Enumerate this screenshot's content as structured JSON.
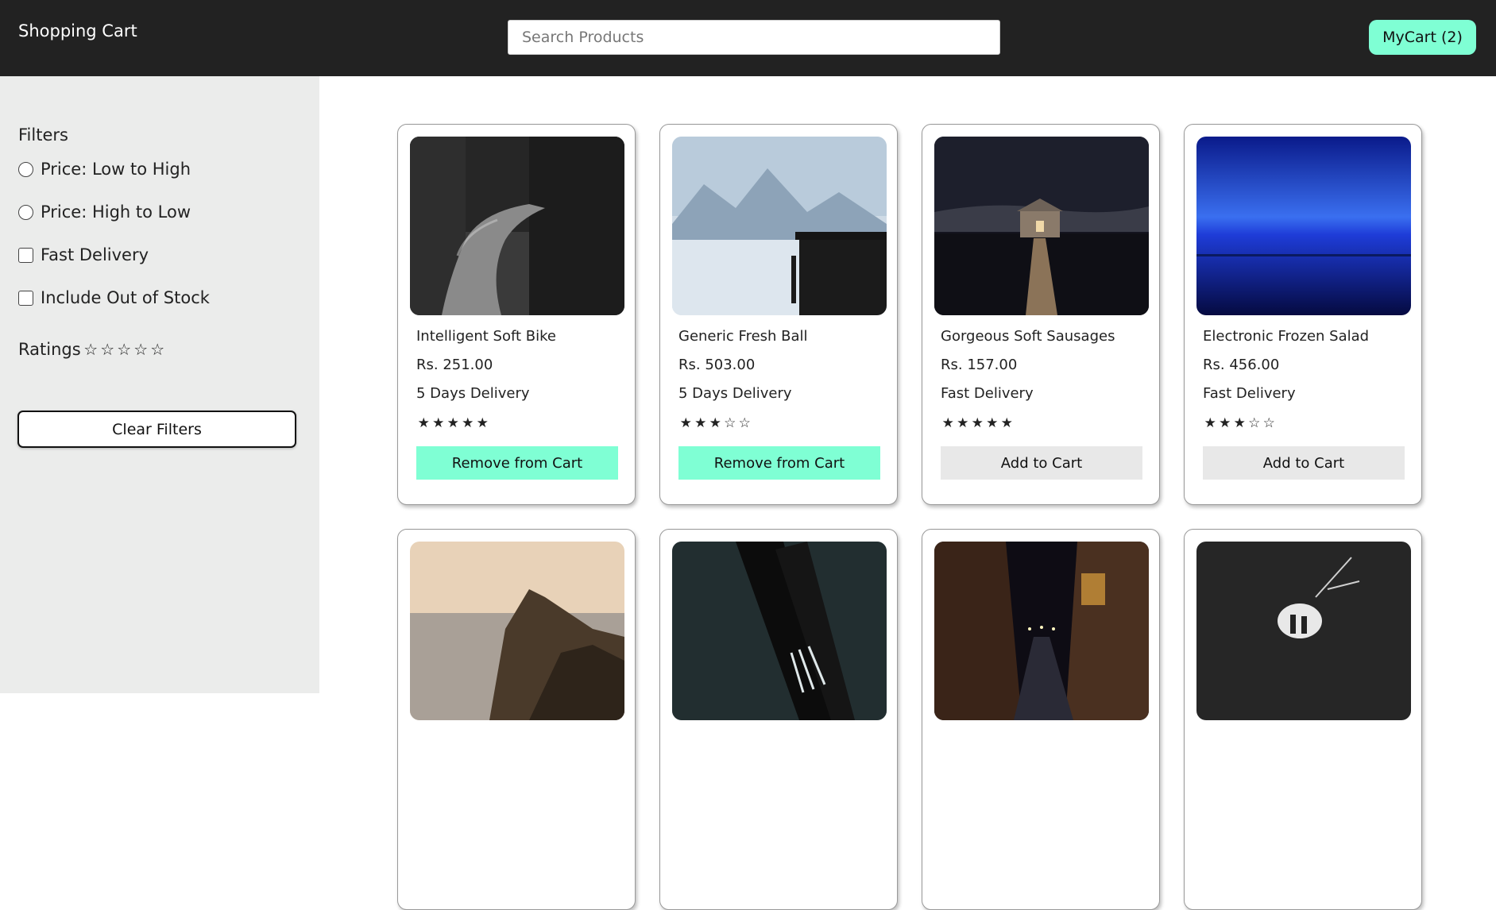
{
  "header": {
    "brand": "Shopping Cart",
    "search_placeholder": "Search Products",
    "cart_label": "MyCart (2)"
  },
  "sidebar": {
    "title": "Filters",
    "options": [
      {
        "type": "radio",
        "label": "Price: Low to High"
      },
      {
        "type": "radio",
        "label": "Price: High to Low"
      },
      {
        "type": "checkbox",
        "label": "Fast Delivery"
      },
      {
        "type": "checkbox",
        "label": "Include Out of Stock"
      }
    ],
    "ratings_label": "Ratings",
    "ratings_value": 0,
    "clear_label": "Clear Filters"
  },
  "products": [
    {
      "name": "Intelligent Soft Bike",
      "price": "Rs. 251.00",
      "delivery": "5 Days Delivery",
      "rating": 5,
      "button": "Remove from Cart",
      "in_cart": true,
      "image": "dark-forest-road"
    },
    {
      "name": "Generic Fresh Ball",
      "price": "Rs. 503.00",
      "delivery": "5 Days Delivery",
      "rating": 3,
      "button": "Remove from Cart",
      "in_cart": true,
      "image": "misty-lake-pier"
    },
    {
      "name": "Gorgeous Soft Sausages",
      "price": "Rs. 157.00",
      "delivery": "Fast Delivery",
      "rating": 5,
      "button": "Add to Cart",
      "in_cart": false,
      "image": "night-boathouse"
    },
    {
      "name": "Electronic Frozen Salad",
      "price": "Rs. 456.00",
      "delivery": "Fast Delivery",
      "rating": 3,
      "button": "Add to Cart",
      "in_cart": false,
      "image": "blue-twilight-lake"
    },
    {
      "name": "",
      "price": "",
      "delivery": "",
      "rating": 0,
      "button": "",
      "in_cart": false,
      "image": "sunset-coast-cliffs"
    },
    {
      "name": "",
      "price": "",
      "delivery": "",
      "rating": 0,
      "button": "",
      "in_cart": false,
      "image": "forks-closeup"
    },
    {
      "name": "",
      "price": "",
      "delivery": "",
      "rating": 0,
      "button": "",
      "in_cart": false,
      "image": "night-street"
    },
    {
      "name": "",
      "price": "",
      "delivery": "",
      "rating": 0,
      "button": "",
      "in_cart": false,
      "image": "cave-silhouettes"
    }
  ],
  "colors": {
    "header_bg": "#222222",
    "accent": "#7fffd4",
    "sidebar_bg": "#ebeceb",
    "add_button_bg": "#e8e8e8"
  }
}
